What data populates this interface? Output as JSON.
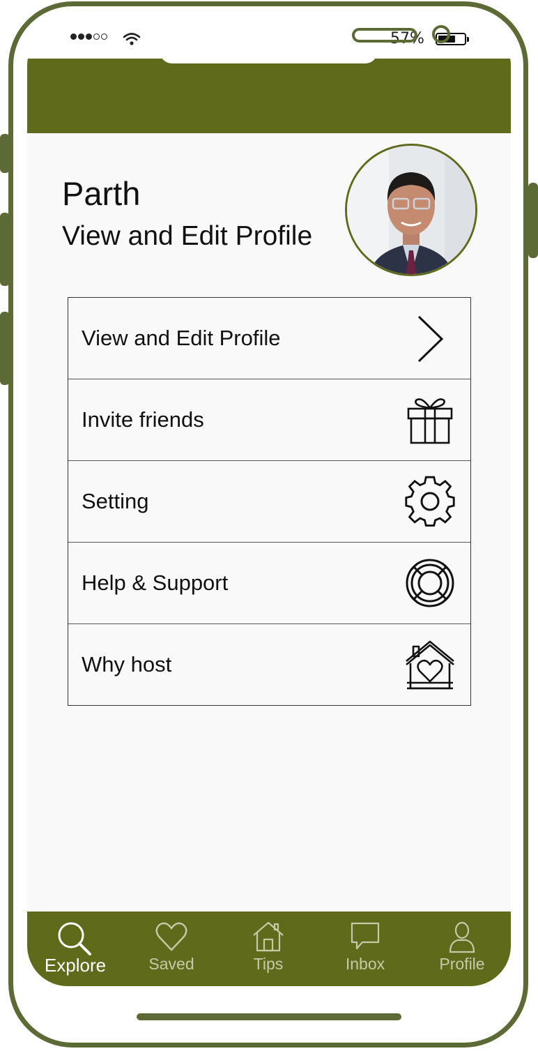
{
  "status": {
    "battery_percent": "57%"
  },
  "profile": {
    "name": "Parth",
    "subtitle": "View and Edit Profile"
  },
  "menu": {
    "items": [
      {
        "label": "View and Edit Profile",
        "icon": "chevron-right-icon"
      },
      {
        "label": "Invite friends",
        "icon": "gift-icon"
      },
      {
        "label": "Setting",
        "icon": "gear-icon"
      },
      {
        "label": "Help & Support",
        "icon": "lifebuoy-icon"
      },
      {
        "label": "Why host",
        "icon": "house-heart-icon"
      }
    ]
  },
  "tabs": [
    {
      "label": "Explore",
      "icon": "search-icon",
      "active": true
    },
    {
      "label": "Saved",
      "icon": "heart-icon",
      "active": false
    },
    {
      "label": "Tips",
      "icon": "home-icon",
      "active": false
    },
    {
      "label": "Inbox",
      "icon": "chat-icon",
      "active": false
    },
    {
      "label": "Profile",
      "icon": "user-icon",
      "active": false
    }
  ],
  "colors": {
    "accent": "#5f6a1b",
    "frame": "#5c6a35",
    "background": "#f9f9f9",
    "tab_inactive": "#c5cba8"
  }
}
